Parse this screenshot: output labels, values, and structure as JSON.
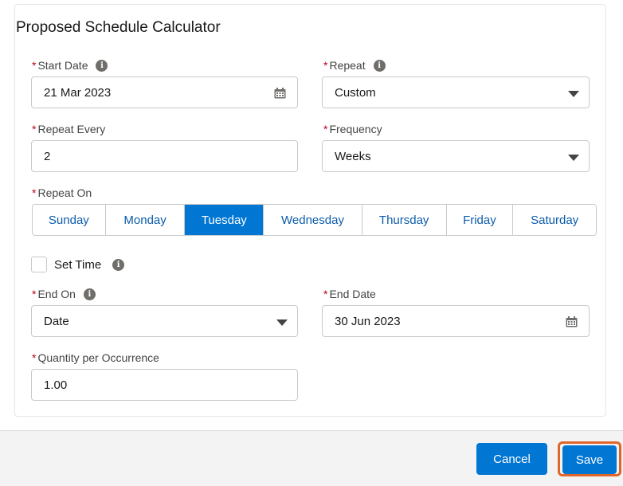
{
  "form": {
    "title": "Proposed Schedule Calculator",
    "required_marker": "*",
    "info_glyph": "i",
    "start_date": {
      "label": "Start Date",
      "value": "21 Mar 2023"
    },
    "repeat": {
      "label": "Repeat",
      "value": "Custom"
    },
    "repeat_every": {
      "label": "Repeat Every",
      "value": "2"
    },
    "frequency": {
      "label": "Frequency",
      "value": "Weeks"
    },
    "repeat_on": {
      "label": "Repeat On",
      "days": [
        "Sunday",
        "Monday",
        "Tuesday",
        "Wednesday",
        "Thursday",
        "Friday",
        "Saturday"
      ],
      "selected": "Tuesday"
    },
    "set_time": {
      "label": "Set Time",
      "checked": false
    },
    "end_on": {
      "label": "End On",
      "value": "Date"
    },
    "end_date": {
      "label": "End Date",
      "value": "30 Jun 2023"
    },
    "quantity": {
      "label": "Quantity per Occurrence",
      "value": "1.00"
    }
  },
  "footer": {
    "cancel_label": "Cancel",
    "save_label": "Save"
  },
  "colors": {
    "brand": "#0176d3",
    "required": "#ba0517",
    "highlight": "#e0652b"
  }
}
